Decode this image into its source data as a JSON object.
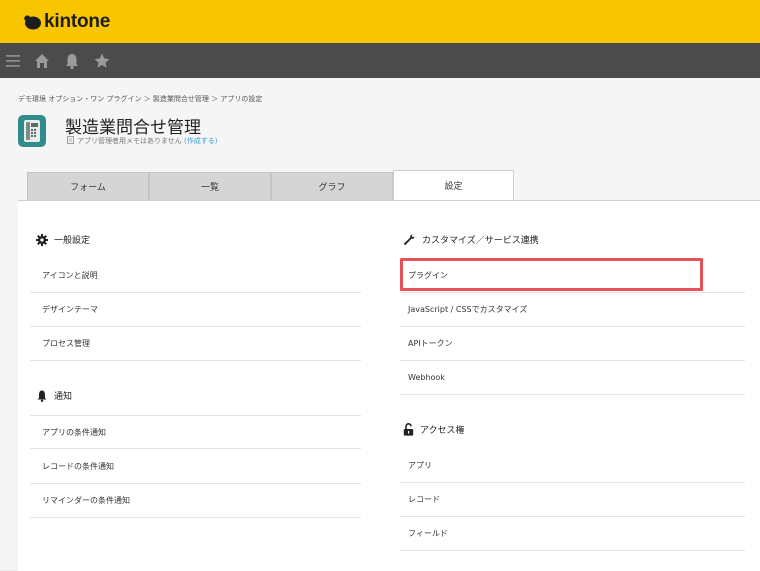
{
  "header": {
    "logo_text": "kintone"
  },
  "navbar": {
    "icons": [
      "menu-icon",
      "home-icon",
      "bell-icon",
      "star-icon"
    ]
  },
  "breadcrumb": "デモ環境 オプション・ワン プラグイン ＞ 製造業問合せ管理 ＞ アプリの設定",
  "app": {
    "title": "製造業問合せ管理",
    "memo": "アプリ管理者用メモはありません",
    "memo_link": "(作成する)",
    "icon": "phone-app-icon"
  },
  "tabs": [
    {
      "label": "フォーム"
    },
    {
      "label": "一覧"
    },
    {
      "label": "グラフ"
    },
    {
      "label": "設定",
      "active": true
    }
  ],
  "left": {
    "general": {
      "heading": "一般設定",
      "items": [
        "アイコンと説明",
        "デザインテーマ",
        "プロセス管理"
      ]
    },
    "notify": {
      "heading": "通知",
      "items": [
        "アプリの条件通知",
        "レコードの条件通知",
        "リマインダーの条件通知"
      ]
    }
  },
  "right": {
    "customize": {
      "heading": "カスタマイズ／サービス連携",
      "items": [
        "プラグイン",
        "JavaScript / CSSでカスタマイズ",
        "APIトークン",
        "Webhook"
      ]
    },
    "access": {
      "heading": "アクセス権",
      "items": [
        "アプリ",
        "レコード",
        "フィールド"
      ]
    }
  },
  "colors": {
    "header": "#f7c600",
    "navbar": "#4b4b4b",
    "highlight": "#e8505b",
    "link": "#3498db"
  }
}
